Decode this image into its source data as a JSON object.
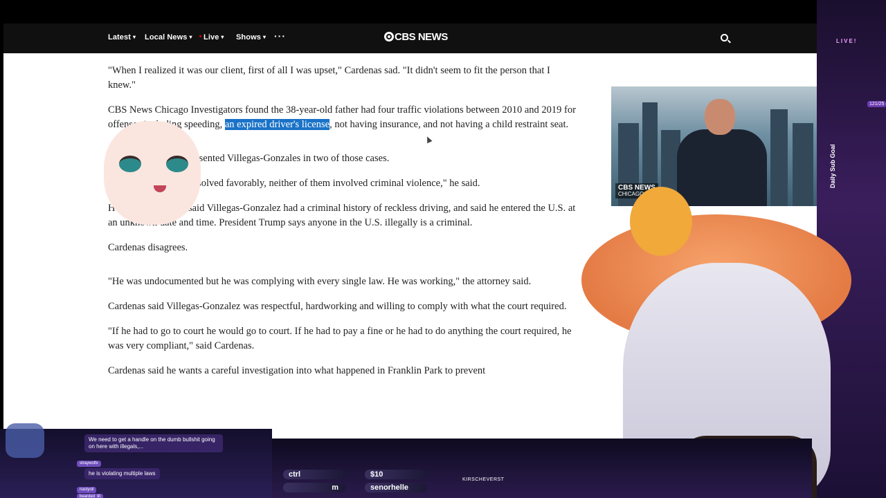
{
  "nav": {
    "items": [
      {
        "label": "Latest"
      },
      {
        "label": "Local News"
      },
      {
        "label": "Live"
      },
      {
        "label": "Shows"
      }
    ],
    "more_label": "···",
    "logo": "CBS NEWS"
  },
  "article": {
    "p1": "\"When I realized it was our client, first of all I was upset,\" Cardenas sad. \"It didn't seem to fit the person that I knew.\"",
    "p2_before": "CBS News Chicago Investigators found the 38-year-old father had four traffic violations between 2010 and 2019 for offenses including speeding, ",
    "p2_highlight": "an expired driver's license",
    "p2_after": ", not having insurance, and not having a child restraint seat.",
    "p3": "Cardenas said he represented Villegas-Gonzales in two of those cases.",
    "p4": "\"Both of them were resolved favorably, neither of them involved criminal violence,\" he said.",
    "p5": "Homeland Security said Villegas-Gonzalez had a criminal history of reckless driving, and said he entered the U.S. at an unknown date and time. President Trump says anyone in the U.S. illegally is a criminal.",
    "p6": "Cardenas disagrees.",
    "p7": "\"He was undocumented but he was complying with every single law. He was working,\" the attorney said.",
    "p8": "Cardenas said Villegas-Gonzalez was respectful, hardworking and willing to comply with what the court required.",
    "p9": "\"If he had to go to court he would go to court. If he had to pay a fine or he had to do anything the court required, he was very compliant,\" said Cardenas.",
    "p10": "Cardenas said he wants a careful investigation into what happened in Franklin Park to prevent"
  },
  "video": {
    "logo_top": "CBS NEWS",
    "logo_bottom": "CHICAGO"
  },
  "stream": {
    "live_badge": "LIVE!",
    "sub_goal": "Daily Sub Goal",
    "goal_count": "121/25",
    "pill_ctrl": "ctrl",
    "pill_amount": "$10",
    "pill_m": "m",
    "pill_user": "senorhelle",
    "handle": "KIRSCHEVERST"
  },
  "chat": {
    "msg1": "We need to get a handle on the dumb bullshit going on here with illegals,...",
    "user2": "straywolfx",
    "msg2": "he is violating multiple laws",
    "user3": "nastyoil",
    "user4": "bearded_tit"
  },
  "colors": {
    "nav_bg": "#101010",
    "highlight": "#1a73c8"
  }
}
